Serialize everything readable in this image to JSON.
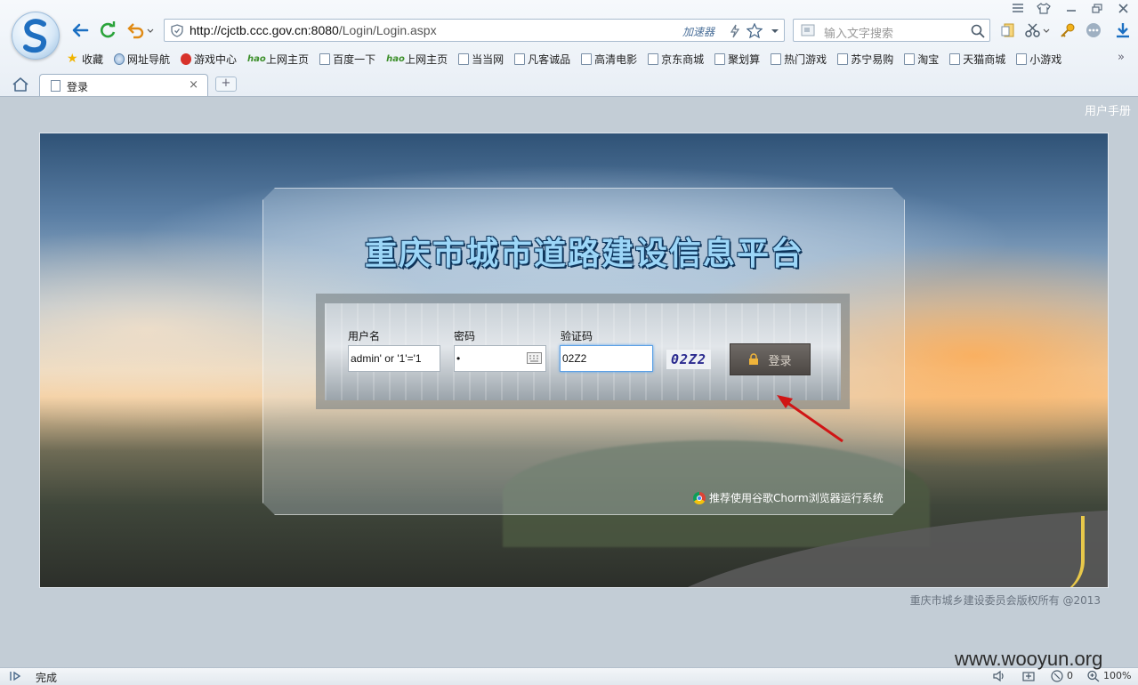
{
  "browser": {
    "address_host": "http://cjctb.ccc.gov.cn:8080",
    "address_path": "/Login/Login.aspx",
    "accelerator_label": "加速器",
    "search_placeholder": "输入文字搜索",
    "bookmarks": [
      {
        "label": "收藏",
        "icon": "star-icon"
      },
      {
        "label": "网址导航",
        "icon": "globe-icon"
      },
      {
        "label": "游戏中心",
        "icon": "game-icon"
      },
      {
        "label": "上网主页",
        "icon": "hao-icon"
      },
      {
        "label": "百度一下",
        "icon": "page-icon"
      },
      {
        "label": "上网主页",
        "icon": "hao-icon"
      },
      {
        "label": "当当网",
        "icon": "page-icon"
      },
      {
        "label": "凡客诚品",
        "icon": "page-icon"
      },
      {
        "label": "高清电影",
        "icon": "page-icon"
      },
      {
        "label": "京东商城",
        "icon": "page-icon"
      },
      {
        "label": "聚划算",
        "icon": "page-icon"
      },
      {
        "label": "热门游戏",
        "icon": "page-icon"
      },
      {
        "label": "苏宁易购",
        "icon": "page-icon"
      },
      {
        "label": "淘宝",
        "icon": "page-icon"
      },
      {
        "label": "天猫商城",
        "icon": "page-icon"
      },
      {
        "label": "小游戏",
        "icon": "page-icon"
      }
    ],
    "bookmarks_more": "»",
    "tab_title": "登录",
    "tab_close": "×",
    "new_tab": "+",
    "status_text": "完成",
    "status_count": "0",
    "zoom": "100%",
    "hao_text": "hao"
  },
  "page": {
    "user_manual": "用户手册",
    "platform_title": "重庆市城市道路建设信息平台",
    "form": {
      "username_label": "用户名",
      "username_value": "admin' or '1'='1",
      "password_label": "密码",
      "password_value": "•",
      "captcha_label": "验证码",
      "captcha_value": "02Z2",
      "captcha_image_text": "02Z2",
      "login_button": "登录"
    },
    "recommend": "推荐使用谷歌Chorm浏览器运行系统",
    "copyright": "重庆市城乡建设委员会版权所有 @2013"
  },
  "watermark": "www.wooyun.org",
  "colors": {
    "annotation_arrow": "#d01515",
    "focus_border": "#5aa0e6",
    "login_button_bg": "#5c5753"
  }
}
